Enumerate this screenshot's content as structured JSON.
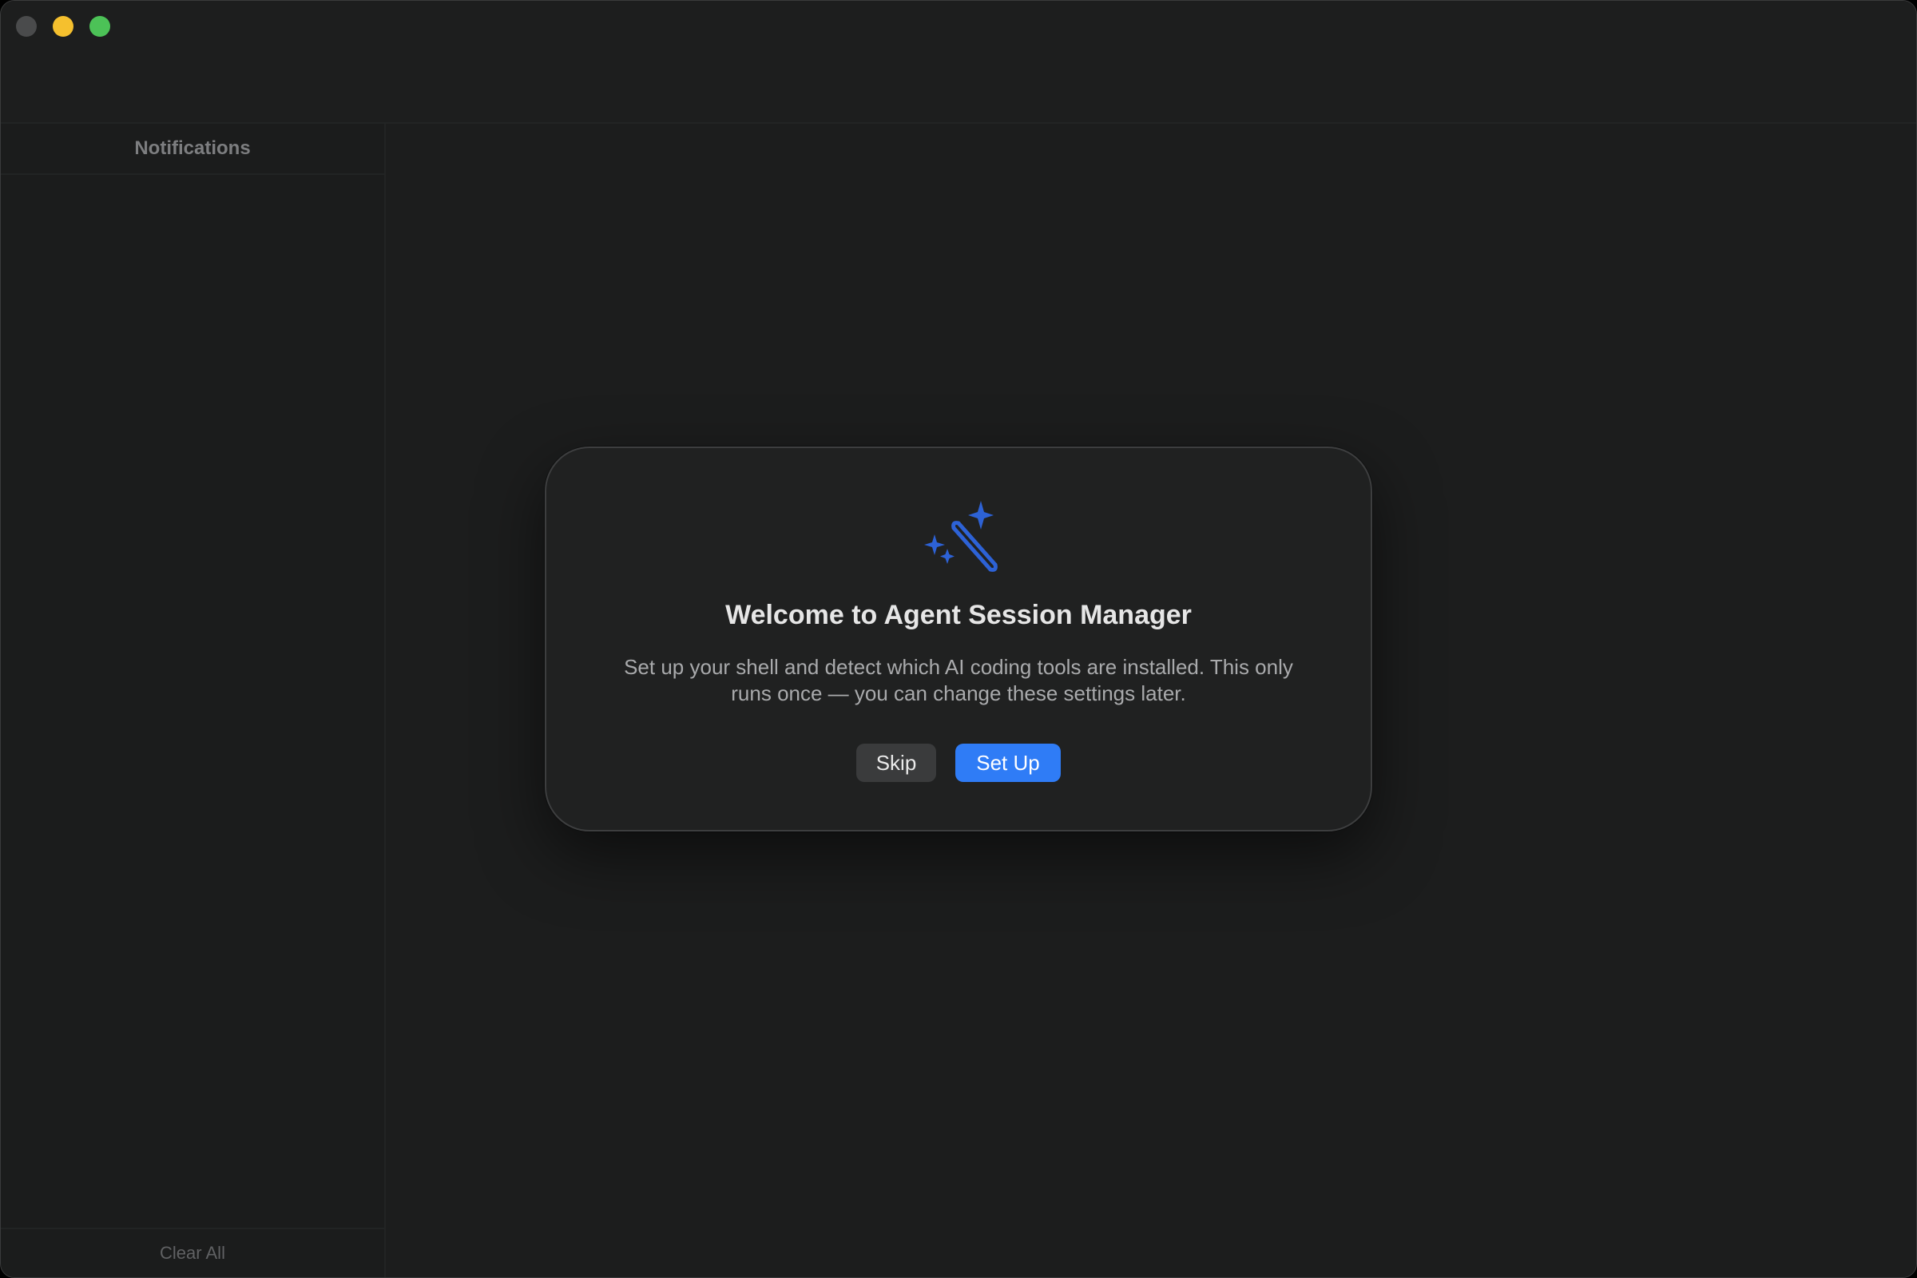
{
  "window": {
    "controls": [
      "close",
      "minimize",
      "zoom"
    ]
  },
  "sidebar": {
    "title": "Notifications",
    "footer_action": "Clear All"
  },
  "dialog": {
    "icon": "magic-wand-sparkles-icon",
    "title": "Welcome to Agent Session Manager",
    "body": "Set up your shell and detect which AI coding tools are installed. This only runs once — you can change these settings later.",
    "skip_label": "Skip",
    "setup_label": "Set Up"
  },
  "colors": {
    "accent": "#2f7cf6",
    "icon": "#2d62d6",
    "close": "#4a4b4c",
    "minimize": "#f5c02e",
    "zoom": "#4cc257"
  }
}
